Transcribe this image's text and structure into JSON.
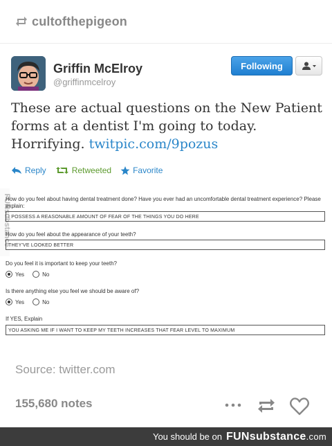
{
  "reblog": {
    "username": "cultofthepigeon",
    "icon": "reblog-icon"
  },
  "tweet": {
    "author_name": "Griffin McElroy",
    "author_handle": "@griffinmcelroy",
    "follow_label": "Following",
    "user_menu_icon": "user-dropdown-icon",
    "text_before_link": "These are actual questions on the New Patient forms at a dentist I'm going to today. Horrifying. ",
    "link_text": "twitpic.com/9pozus",
    "actions": {
      "reply": "Reply",
      "retweeted": "Retweeted",
      "favorite": "Favorite"
    },
    "colors": {
      "link": "#2a86c9",
      "retweeted": "#5c9a2e",
      "follow_button": "#1f7fd1"
    }
  },
  "form": {
    "watermark": "FUNsubstance",
    "q1": "How do you feel about having dental treatment done?  Have you ever had an uncomfortable dental treatment experience?  Please explain:",
    "a1": "I POSSESS A REASONABLE AMOUNT OF FEAR OF THE THINGS YOU DO HERE",
    "q2": "How do you feel about the appearance of your teeth?",
    "a2": "THEY'VE LOOKED BETTER",
    "q3": "Do you feel it is important to keep your teeth?",
    "q3_yes": "Yes",
    "q3_no": "No",
    "q4": "Is there anything else you feel we should be aware of?",
    "q4_yes": "Yes",
    "q4_no": "No",
    "q5": "If YES, Explain",
    "a5": "YOU ASKING ME IF I WANT TO KEEP MY TEETH INCREASES THAT FEAR LEVEL TO MAXIMUM"
  },
  "post": {
    "source": "Source: twitter.com",
    "notes": "155,680 notes",
    "icons": [
      "more-icon",
      "reblog-icon",
      "like-icon"
    ]
  },
  "footer": {
    "text": "You should be on",
    "brand_fun": "FUN",
    "brand_rest": "substance",
    "brand_tld": ".com"
  }
}
